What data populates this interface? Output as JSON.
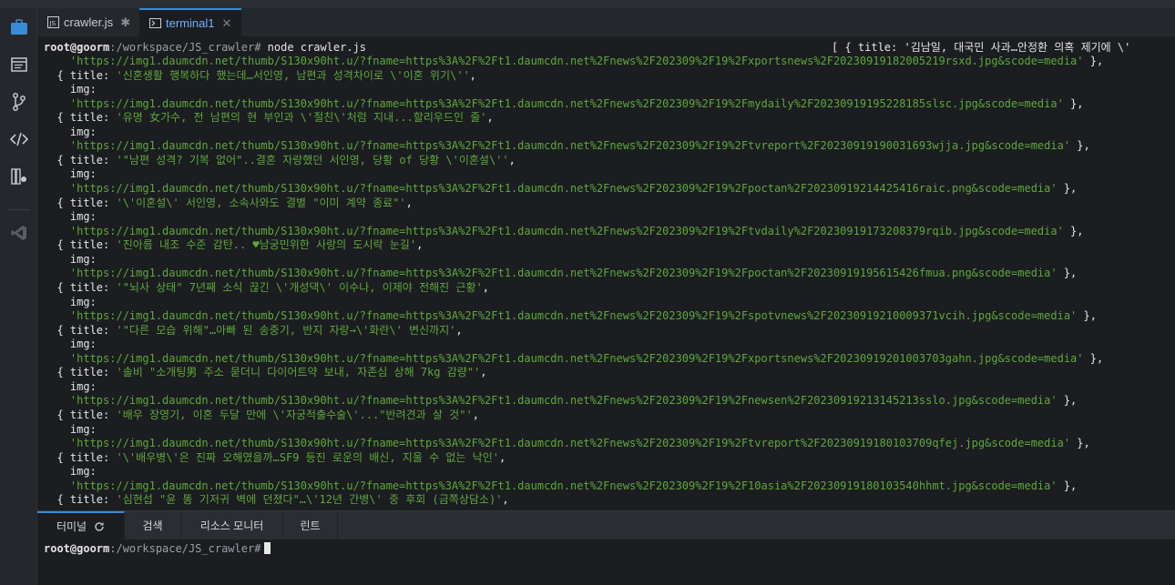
{
  "tabs": [
    {
      "label": "crawler.js",
      "close": "✱",
      "icon": "js-file-icon"
    },
    {
      "label": "terminal1",
      "close": "✕",
      "icon": "terminal-icon"
    }
  ],
  "terminal": {
    "prompt_user": "root@goorm",
    "prompt_path": ":/workspace/JS_crawler#",
    "command": " node crawler.js",
    "right_overflow": "[ { title: '김남일, 대국민 사과…안정환 의혹 제기에 \\'",
    "lines": [
      "    'https://img1.daumcdn.net/thumb/S130x90ht.u/?fname=https%3A%2F%2Ft1.daumcdn.net%2Fnews%2F202309%2F19%2Fxportsnews%2F20230919182005219rsxd.jpg&scode=media' },",
      "  { title: '신혼생활 행복하다 했는데…서인영, 남편과 성격차이로 \\'이혼 위기\\'',",
      "    img:",
      "    'https://img1.daumcdn.net/thumb/S130x90ht.u/?fname=https%3A%2F%2Ft1.daumcdn.net%2Fnews%2F202309%2F19%2Fmydaily%2F20230919195228185slsc.jpg&scode=media' },",
      "  { title: '유명 女가수, 전 남편의 현 부인과 \\'절친\\'처럼 지내...할리우드인 줄',",
      "    img:",
      "    'https://img1.daumcdn.net/thumb/S130x90ht.u/?fname=https%3A%2F%2Ft1.daumcdn.net%2Fnews%2F202309%2F19%2Ftvreport%2F20230919190031693wjja.jpg&scode=media' },",
      "  { title: '\"남편 성격? 기복 없어\"..결혼 자랑했던 서인영, 당황 of 당황 \\'이혼설\\'',",
      "    img:",
      "    'https://img1.daumcdn.net/thumb/S130x90ht.u/?fname=https%3A%2F%2Ft1.daumcdn.net%2Fnews%2F202309%2F19%2Fpoctan%2F20230919214425416raic.png&scode=media' },",
      "  { title: '\\'이혼설\\' 서인영, 소속사와도 결별 \"이미 계약 종료\"',",
      "    img:",
      "    'https://img1.daumcdn.net/thumb/S130x90ht.u/?fname=https%3A%2F%2Ft1.daumcdn.net%2Fnews%2F202309%2F19%2Ftvdaily%2F20230919173208379rqib.jpg&scode=media' },",
      "  { title: '진아름 내조 수준 감탄.. ♥남궁민위한 사랑의 도시락 눈길',",
      "    img:",
      "    'https://img1.daumcdn.net/thumb/S130x90ht.u/?fname=https%3A%2F%2Ft1.daumcdn.net%2Fnews%2F202309%2F19%2Fpoctan%2F20230919195615426fmua.png&scode=media' },",
      "  { title: '\"뇌사 상태\" 7년째 소식 끊긴 \\'개성댁\\' 이수나, 이제야 전해진 근황',",
      "    img:",
      "    'https://img1.daumcdn.net/thumb/S130x90ht.u/?fname=https%3A%2F%2Ft1.daumcdn.net%2Fnews%2F202309%2F19%2Fspotvnews%2F20230919210009371vcih.jpg&scode=media' },",
      "  { title: '\"다른 모습 위해\"…아빠 된 송중기, 반지 자랑→\\'화란\\' 변신까지',",
      "    img:",
      "    'https://img1.daumcdn.net/thumb/S130x90ht.u/?fname=https%3A%2F%2Ft1.daumcdn.net%2Fnews%2F202309%2F19%2Fxportsnews%2F20230919201003703gahn.jpg&scode=media' },",
      "  { title: '솔비 \"소개팅男 주소 묻더니 다이어트약 보내, 자존심 상해 7kg 감량\"',",
      "    img:",
      "    'https://img1.daumcdn.net/thumb/S130x90ht.u/?fname=https%3A%2F%2Ft1.daumcdn.net%2Fnews%2F202309%2F19%2Fnewsen%2F20230919213145213sslo.jpg&scode=media' },",
      "  { title: '배우 장영기, 이혼 두달 만에 \\'자궁적출수술\\'...\"반려견과 살 것\"',",
      "    img:",
      "    'https://img1.daumcdn.net/thumb/S130x90ht.u/?fname=https%3A%2F%2Ft1.daumcdn.net%2Fnews%2F202309%2F19%2Ftvreport%2F20230919180103709qfej.jpg&scode=media' },",
      "  { title: '\\'배우병\\'은 진짜 오해였을까…SF9 등진 로운의 배신, 지울 수 없는 낙인',",
      "    img:",
      "    'https://img1.daumcdn.net/thumb/S130x90ht.u/?fname=https%3A%2F%2Ft1.daumcdn.net%2Fnews%2F202309%2F19%2F10asia%2F20230919180103540hhmt.jpg&scode=media' },",
      "  { title: '심현섭 \"윤 똥 기저귀 벽에 던졌다\"…\\'12년 간병\\' 중 후회 (금쪽상담소)',"
    ]
  },
  "panel": {
    "tabs": [
      "터미널",
      "검색",
      "리소스 모니터",
      "린트"
    ]
  },
  "terminal2": {
    "prompt_user": "root@goorm",
    "prompt_path": ":/workspace/JS_crawler#"
  }
}
